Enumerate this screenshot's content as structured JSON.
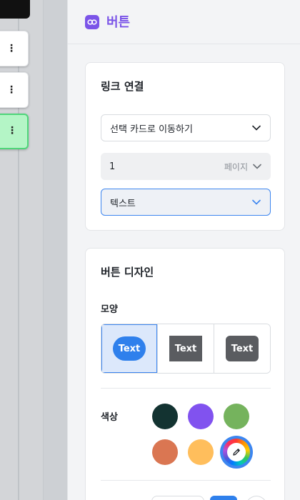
{
  "panel": {
    "title": "버튼",
    "header_icon": "link-icon"
  },
  "link_section": {
    "title": "링크 연결",
    "action_select": "선택 카드로 이동하기",
    "page_value": "1",
    "page_unit": "페이지",
    "style_select": "텍스트"
  },
  "design_section": {
    "title": "버튼 디자인",
    "shape_label": "모양",
    "shapes": [
      {
        "label": "Text",
        "style": "pill",
        "selected": true
      },
      {
        "label": "Text",
        "style": "square",
        "selected": false
      },
      {
        "label": "Text",
        "style": "rounded",
        "selected": false
      }
    ],
    "color_label": "색상",
    "colors": [
      "#133331",
      "#8152ef",
      "#75b35d",
      "#da7652",
      "#ffbe5c"
    ],
    "color_picker_icon": "pencil-icon"
  },
  "colors": {
    "accent_purple": "#7b54e8",
    "accent_blue": "#3d86f0"
  }
}
